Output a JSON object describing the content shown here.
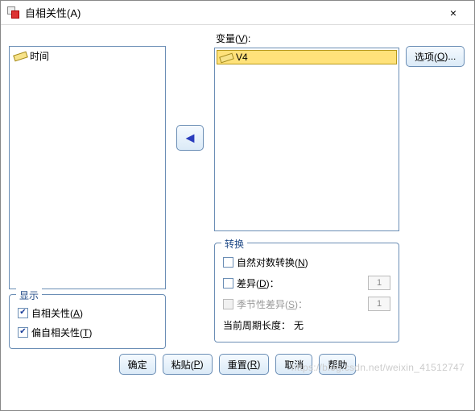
{
  "window": {
    "title": "自相关性(A)",
    "close": "×"
  },
  "leftList": {
    "items": [
      {
        "icon": "ruler-icon",
        "label": "时间"
      }
    ]
  },
  "rightPanel": {
    "label_pre": "变量(",
    "label_accel": "V",
    "label_post": "):",
    "items": [
      {
        "icon": "ruler-icon",
        "label": "V4",
        "selected": true
      }
    ]
  },
  "arrowBtn": {
    "glyph": "◄"
  },
  "options": {
    "label_pre": "选项(",
    "label_accel": "O",
    "label_post": ")..."
  },
  "display": {
    "legend": "显示",
    "items": [
      {
        "label_pre": "自相关性(",
        "label_accel": "A",
        "label_post": ")",
        "checked": true
      },
      {
        "label_pre": "偏自相关性(",
        "label_accel": "T",
        "label_post": ")",
        "checked": true
      }
    ]
  },
  "transform": {
    "legend": "转换",
    "log": {
      "label_pre": "自然对数转换(",
      "label_accel": "N",
      "label_post": ")",
      "checked": false
    },
    "diff": {
      "label_pre": "差异(",
      "label_accel": "D",
      "label_post": ")：",
      "checked": false,
      "value": "1"
    },
    "seasonal": {
      "label_pre": "季节性差异(",
      "label_accel": "S",
      "label_post": ")：",
      "disabled": true,
      "value": "1"
    },
    "periodLabel": "当前周期长度：",
    "periodValue": "无"
  },
  "buttons": {
    "ok": "确定",
    "paste_pre": "粘贴(",
    "paste_accel": "P",
    "paste_post": ")",
    "reset_pre": "重置(",
    "reset_accel": "R",
    "reset_post": ")",
    "cancel": "取消",
    "help": "帮助"
  },
  "watermark": "https://blog.csdn.net/weixin_41512747"
}
